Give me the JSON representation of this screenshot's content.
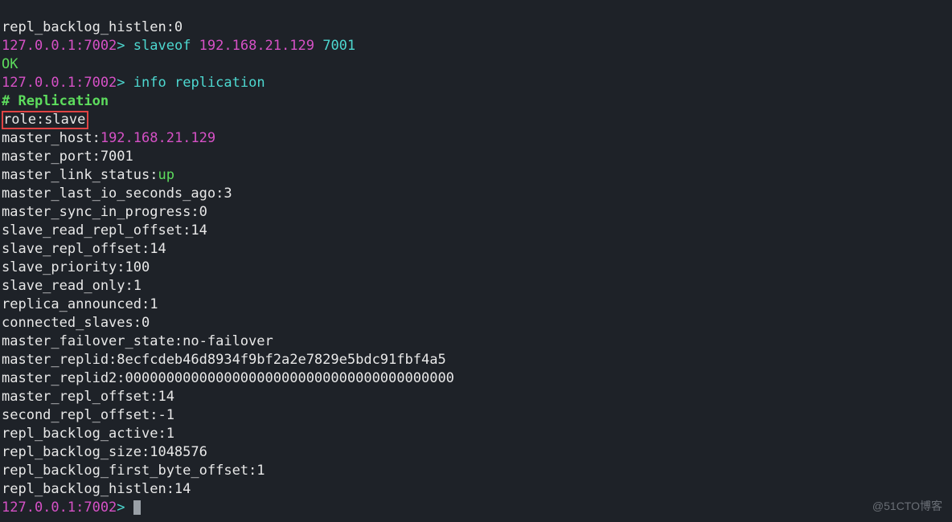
{
  "line0": "repl_backlog_histlen:0",
  "prompt1_hostport": "127.0.0.1:7002",
  "prompt1_gt": "> ",
  "cmd1": "slaveof ",
  "cmd1_ip": "192.168.21.129",
  "cmd1_port": " 7001",
  "ok": "OK",
  "prompt2_hostport": "127.0.0.1:7002",
  "prompt2_gt": "> ",
  "cmd2_a": "info ",
  "cmd2_b": "replication",
  "hdr": "# Replication",
  "role_line": "role:slave",
  "mh_k": "master_host:",
  "mh_v": "192.168.21.129",
  "mp": "master_port:7001",
  "mls_k": "master_link_status:",
  "mls_v": "up",
  "mlio": "master_last_io_seconds_ago:3",
  "msip": "master_sync_in_progress:0",
  "srro": "slave_read_repl_offset:14",
  "sro": "slave_repl_offset:14",
  "spr": "slave_priority:100",
  "sron": "slave_read_only:1",
  "ra": "replica_announced:1",
  "cs": "connected_slaves:0",
  "mfs": "master_failover_state:no-failover",
  "mrid": "master_replid:8ecfcdeb46d8934f9bf2a2e7829e5bdc91fbf4a5",
  "mrid2": "master_replid2:0000000000000000000000000000000000000000",
  "mro": "master_repl_offset:14",
  "sro2": "second_repl_offset:-1",
  "rba": "repl_backlog_active:1",
  "rbs": "repl_backlog_size:1048576",
  "rbfbo": "repl_backlog_first_byte_offset:1",
  "rbh": "repl_backlog_histlen:14",
  "prompt3_hostport": "127.0.0.1:7002",
  "prompt3_gt": "> ",
  "watermark": "@51CTO博客"
}
